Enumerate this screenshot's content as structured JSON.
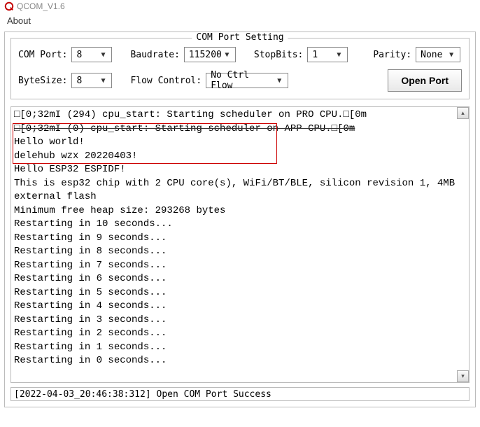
{
  "window": {
    "title": "QCOM_V1.6"
  },
  "menu": {
    "about": "About"
  },
  "panel": {
    "legend": "COM Port Setting",
    "labels": {
      "comport": "COM Port:",
      "baudrate": "Baudrate:",
      "stopbits": "StopBits:",
      "parity": "Parity:",
      "bytesize": "ByteSize:",
      "flowcontrol": "Flow Control:"
    },
    "values": {
      "comport": "8",
      "baudrate": "115200",
      "stopbits": "1",
      "parity": "None",
      "bytesize": "8",
      "flowcontrol": "No Ctrl Flow"
    },
    "open_button": "Open Port"
  },
  "terminal": {
    "lines": [
      "□[0;32mI (294) cpu_start: Starting scheduler on PRO CPU.□[0m",
      "□[0;32mI (0) cpu_start: Starting scheduler on APP CPU.□[0m",
      "Hello world!",
      "delehub wzx 20220403!",
      "Hello ESP32 ESPIDF!",
      "This is esp32 chip with 2 CPU core(s), WiFi/BT/BLE, silicon revision 1, 4MB",
      "external flash",
      "Minimum free heap size: 293268 bytes",
      "Restarting in 10 seconds...",
      "Restarting in 9 seconds...",
      "Restarting in 8 seconds...",
      "Restarting in 7 seconds...",
      "Restarting in 6 seconds...",
      "Restarting in 5 seconds...",
      "Restarting in 4 seconds...",
      "Restarting in 3 seconds...",
      "Restarting in 2 seconds...",
      "Restarting in 1 seconds...",
      "Restarting in 0 seconds..."
    ]
  },
  "status": {
    "text": "[2022-04-03_20:46:38:312] Open COM Port Success"
  }
}
